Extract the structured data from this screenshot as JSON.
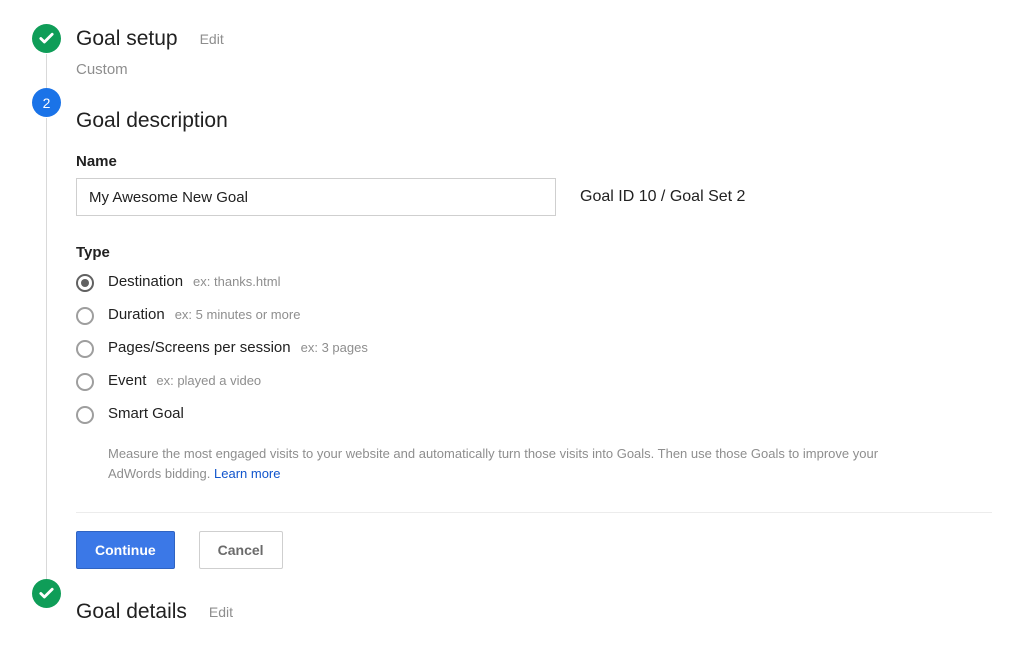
{
  "steps": {
    "setup": {
      "title": "Goal setup",
      "edit": "Edit",
      "subtitle": "Custom"
    },
    "description": {
      "badge": "2",
      "title": "Goal description",
      "name_label": "Name",
      "name_value": "My Awesome New Goal",
      "goal_id_info": "Goal ID 10 / Goal Set 2",
      "type_label": "Type",
      "options": [
        {
          "label": "Destination",
          "hint": "ex: thanks.html"
        },
        {
          "label": "Duration",
          "hint": "ex: 5 minutes or more"
        },
        {
          "label": "Pages/Screens per session",
          "hint": "ex: 3 pages"
        },
        {
          "label": "Event",
          "hint": "ex: played a video"
        },
        {
          "label": "Smart Goal",
          "hint": ""
        }
      ],
      "smart_goal_description": "Measure the most engaged visits to your website and automatically turn those visits into Goals. Then use those Goals to improve your AdWords bidding. ",
      "learn_more": "Learn more",
      "continue": "Continue",
      "cancel": "Cancel"
    },
    "details": {
      "title": "Goal details",
      "edit": "Edit"
    }
  }
}
